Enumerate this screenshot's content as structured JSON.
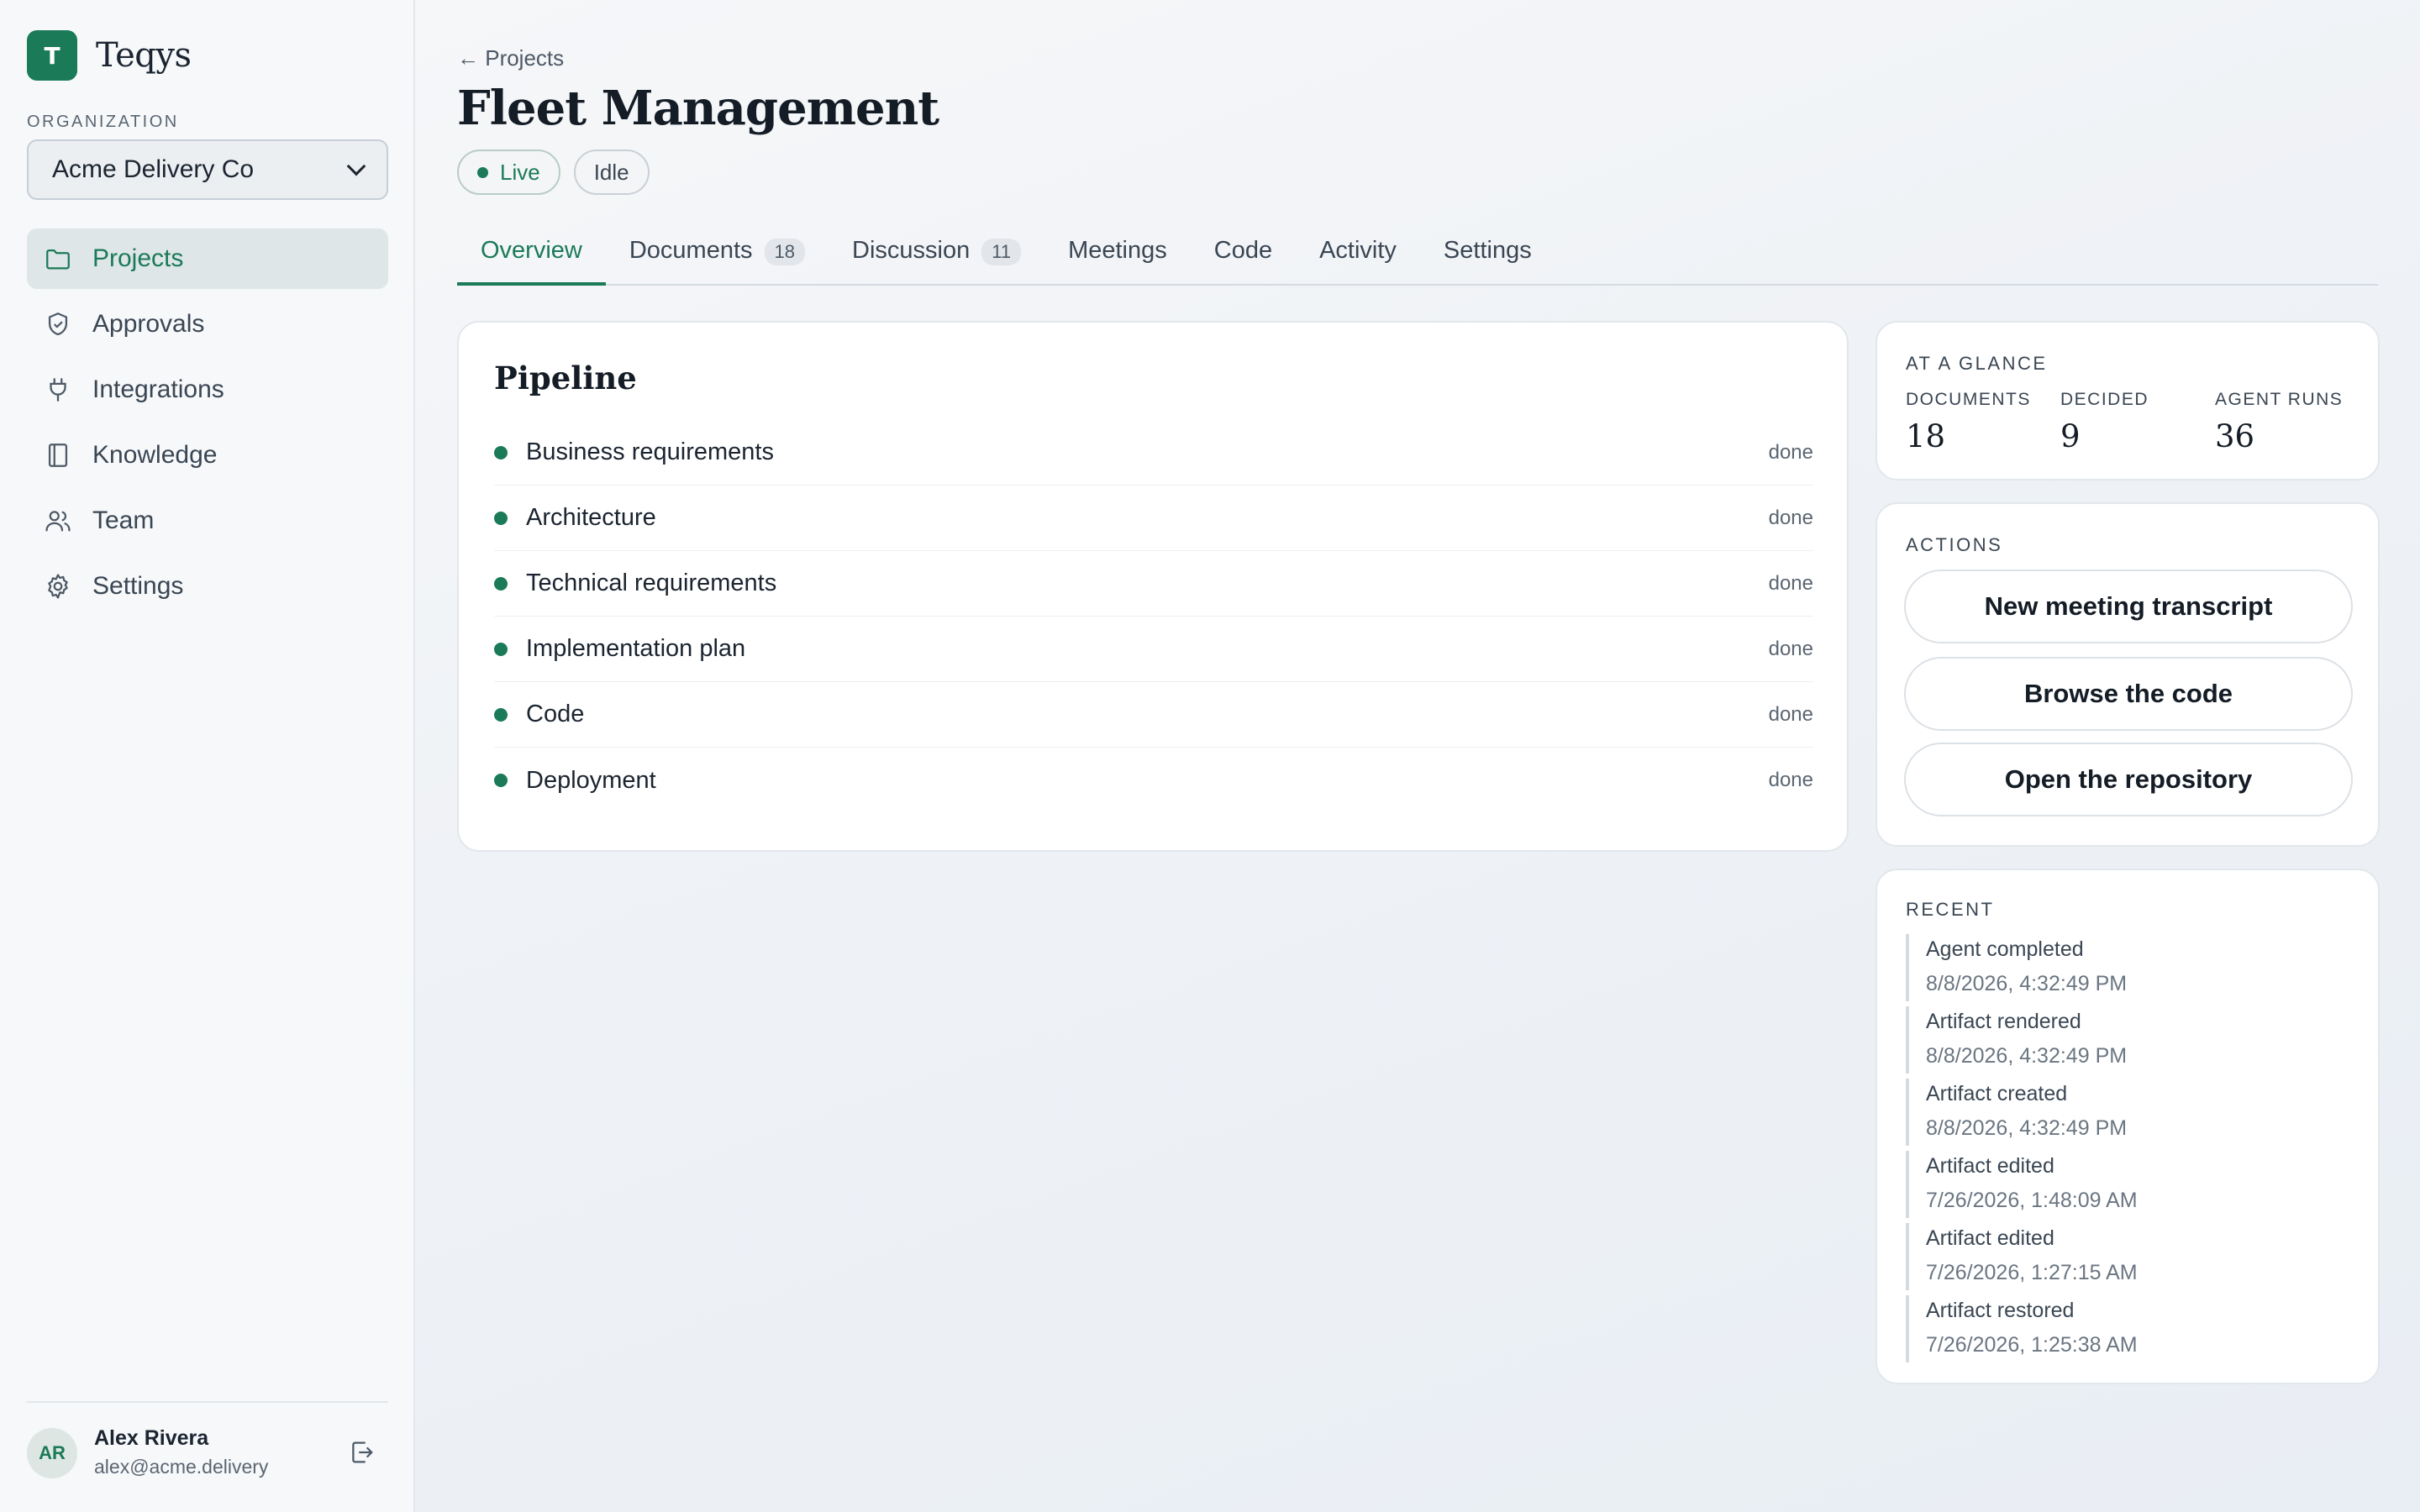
{
  "brand": {
    "logo_letter": "T",
    "name": "Teqys"
  },
  "organization": {
    "label": "ORGANIZATION",
    "selected": "Acme Delivery Co"
  },
  "sidebar": {
    "items": [
      {
        "label": "Projects",
        "icon": "folder-icon",
        "active": true
      },
      {
        "label": "Approvals",
        "icon": "shield-check-icon"
      },
      {
        "label": "Integrations",
        "icon": "plug-icon"
      },
      {
        "label": "Knowledge",
        "icon": "book-icon"
      },
      {
        "label": "Team",
        "icon": "users-icon"
      },
      {
        "label": "Settings",
        "icon": "gear-icon"
      }
    ]
  },
  "user": {
    "initials": "AR",
    "name": "Alex Rivera",
    "email": "alex@acme.delivery"
  },
  "header": {
    "back_label": "← Projects",
    "title": "Fleet Management",
    "status_live": "Live",
    "status_idle": "Idle"
  },
  "tabs": [
    {
      "label": "Overview",
      "active": true
    },
    {
      "label": "Documents",
      "count": "18"
    },
    {
      "label": "Discussion",
      "count": "11"
    },
    {
      "label": "Meetings"
    },
    {
      "label": "Code"
    },
    {
      "label": "Activity"
    },
    {
      "label": "Settings"
    }
  ],
  "pipeline": {
    "title": "Pipeline",
    "steps": [
      {
        "label": "Business requirements",
        "status": "done"
      },
      {
        "label": "Architecture",
        "status": "done"
      },
      {
        "label": "Technical requirements",
        "status": "done"
      },
      {
        "label": "Implementation plan",
        "status": "done"
      },
      {
        "label": "Code",
        "status": "done"
      },
      {
        "label": "Deployment",
        "status": "done"
      }
    ]
  },
  "glance": {
    "label": "AT A GLANCE",
    "stats": [
      {
        "label": "DOCUMENTS",
        "value": "18"
      },
      {
        "label": "DECIDED",
        "value": "9"
      },
      {
        "label": "AGENT RUNS",
        "value": "36"
      }
    ]
  },
  "actions": {
    "label": "ACTIONS",
    "buttons": [
      "New meeting transcript",
      "Browse the code",
      "Open the repository"
    ]
  },
  "recent": {
    "label": "RECENT",
    "events": [
      {
        "title": "Agent completed",
        "time": "8/8/2026, 4:32:49 PM"
      },
      {
        "title": "Artifact rendered",
        "time": "8/8/2026, 4:32:49 PM"
      },
      {
        "title": "Artifact created",
        "time": "8/8/2026, 4:32:49 PM"
      },
      {
        "title": "Artifact edited",
        "time": "7/26/2026, 1:48:09 AM"
      },
      {
        "title": "Artifact edited",
        "time": "7/26/2026, 1:27:15 AM"
      },
      {
        "title": "Artifact restored",
        "time": "7/26/2026, 1:25:38 AM"
      }
    ]
  },
  "colors": {
    "accent": "#1b7a57",
    "background": "#eef2f6",
    "card": "#ffffff"
  }
}
